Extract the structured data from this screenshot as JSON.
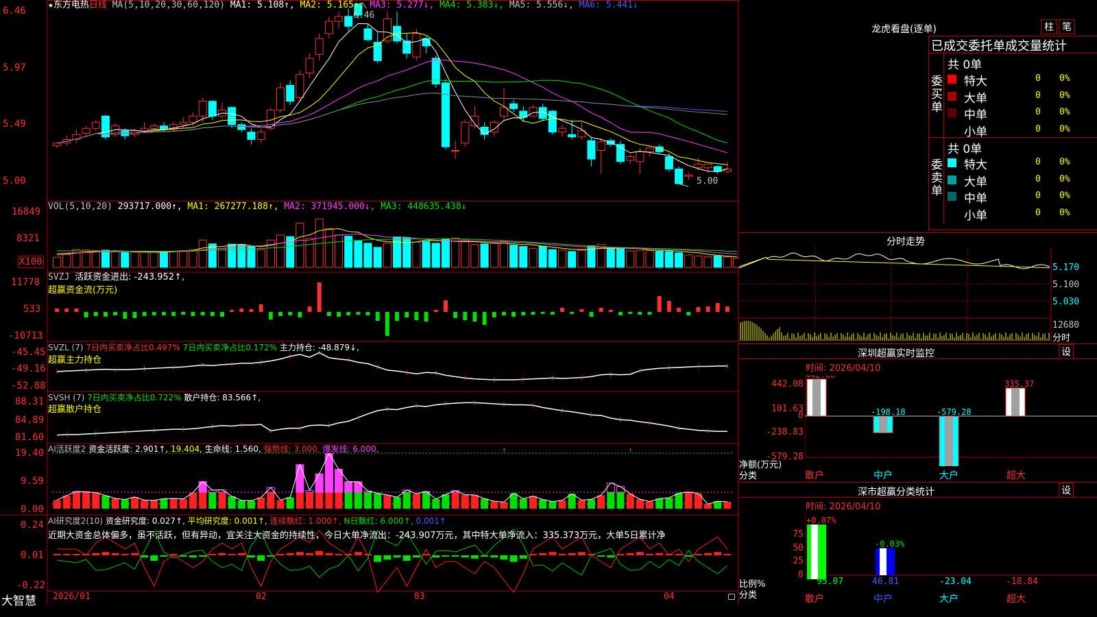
{
  "header": {
    "star": "★",
    "stock_name": "东方电热",
    "period": "日线",
    "ma_params": "MA(5,10,20,30,60,120)",
    "ma1": "MA1: 5.108↑,",
    "ma2": "MA2: 5.165↑,",
    "ma3": "MA3: 5.277↓,",
    "ma4": "MA4: 5.383↓,",
    "ma5": "MA5: 5.556↓,",
    "ma6": "MA6: 5.441↓"
  },
  "price_panel": {
    "y_ticks": [
      "6.46",
      "5.97",
      "5.49",
      "5.00"
    ],
    "high_label": "6.46",
    "low_label": "5.00"
  },
  "vol_panel": {
    "name": "VOL(5,10,20)",
    "value": "293717.000↑,",
    "ma1": "MA1: 267277.188↑,",
    "ma2": "MA2: 371945.000↓,",
    "ma3": "MA3: 448635.438↓",
    "y_ticks": [
      "16849",
      "8321"
    ],
    "unit": "X100"
  },
  "svzj_panel": {
    "name": "SVZJ",
    "label": "活跃资金进出: -243.952↑,",
    "subtitle": "超赢资金流(万元)",
    "y_ticks": [
      "11778",
      "533",
      "-10713"
    ]
  },
  "svzl_panel": {
    "name": "SVZL (7)",
    "label1": "7日内买卖净占比0.497%",
    "label2": "7日内买卖净占比0.172%",
    "label3": "主力持仓: -48.879↓,",
    "subtitle": "超赢主力持仓",
    "y_ticks": [
      "-45.45",
      "-49.16",
      "-52.88"
    ]
  },
  "svsh_panel": {
    "name": "SVSH (7)",
    "label1": "7日内买卖净占比0.722%",
    "label2": "散户持仓: 83.566↑,",
    "subtitle": "超赢散户持仓",
    "y_ticks": [
      "88.31",
      "84.89",
      "81.60"
    ]
  },
  "ai_active": {
    "name": "AI活跃度2",
    "label1": "资金活跃度: 2.901↑,",
    "label2": "19.404,",
    "label3": "生命线: 1.560,",
    "label4": "强势线: 3.000,",
    "label5": "爆发线: 6.000,",
    "y_ticks": [
      "19.40",
      "9.59",
      "0.00"
    ]
  },
  "ai_research": {
    "name": "AI研究度2(10)",
    "label1": "资金研究度: 0.027↑,",
    "label2": "平均研究度: 0.001↑,",
    "label3": "连续飘红: 1.000↑,",
    "label4": "N日飘红: 6.000↑,",
    "label5": "0.001↑",
    "comment": "近期大资金总体偏多，虽不活跃，但有异动，宜关注大资金的持续性，今日大单净流出：-243.907万元，其中特大单净流入：335.373万元，大单5日累计净",
    "y_ticks": [
      "0.24",
      "0.01",
      "-0.22"
    ]
  },
  "date_axis": [
    "2026/01",
    "02",
    "03",
    "04"
  ],
  "bottom_logo": "大智慧",
  "longhu": {
    "title": "龙虎看盘(逐单)",
    "btn1": "柱",
    "btn2": "笔",
    "tabs": [
      "已成交",
      "委托单",
      "成交量统计"
    ],
    "buy_side": "委买单",
    "sell_side": "委卖单",
    "buy_total": "共 0单",
    "sell_total": "共 0单",
    "buy_rows": [
      {
        "label": "特大",
        "val": "0",
        "pct": "0%",
        "color": "#ff0000"
      },
      {
        "label": "大单",
        "val": "0",
        "pct": "0%",
        "color": "#a00000"
      },
      {
        "label": "中单",
        "val": "0",
        "pct": "0%",
        "color": "#600000"
      },
      {
        "label": "小单",
        "val": "0",
        "pct": "0%",
        "color": "#000000"
      }
    ],
    "sell_rows": [
      {
        "label": "特大",
        "val": "0",
        "pct": "0%",
        "color": "#00ffff"
      },
      {
        "label": "大单",
        "val": "0",
        "pct": "0%",
        "color": "#00a0a0"
      },
      {
        "label": "中单",
        "val": "0",
        "pct": "0%",
        "color": "#006868"
      },
      {
        "label": "小单",
        "val": "0",
        "pct": "0%",
        "color": "#000000"
      }
    ]
  },
  "timeshare": {
    "title": "分时走势",
    "y_ticks": [
      "5.170",
      "5.100",
      "5.030"
    ],
    "vol_tick": "12680",
    "vol_unit": "分时"
  },
  "sz_monitor": {
    "title": "深圳超赢实时监控",
    "btn": "设",
    "time": "时间: 2026/04/10",
    "y_ticks": [
      "442.08",
      "101.63",
      "0",
      "-238.83",
      "-579.28"
    ],
    "unit1": "净额(万元)",
    "unit2": "分类",
    "categories": [
      "散户",
      "中户",
      "大户",
      "超大"
    ],
    "values": [
      442.08,
      -198.18,
      -579.28,
      335.37
    ],
    "value_labels": [
      "442.08",
      "-198.18",
      "-579.28",
      "335.37"
    ]
  },
  "sz_category": {
    "title": "深市超赢分类统计",
    "btn": "设",
    "time": "时间: 2026/04/10",
    "y_ticks": [
      "75",
      "50",
      "25",
      "0"
    ],
    "unit1": "比例%",
    "unit2": "分类",
    "categories": [
      "散户",
      "中户",
      "大户",
      "超大"
    ],
    "top_labels": [
      "+0.07%",
      "-0.03%"
    ],
    "values": [
      95.07,
      46.81,
      -23.04,
      -18.84
    ],
    "value_labels": [
      "95.07",
      "46.81",
      "-23.04",
      "-18.84"
    ]
  },
  "colors": {
    "up": "#ff3030",
    "down": "#00ffff",
    "ma1": "#ffffff",
    "ma2": "#ffff00",
    "ma3": "#ff40ff",
    "ma4": "#00e000",
    "ma5": "#808080",
    "ma6": "#4060ff",
    "grid": "#b00000"
  },
  "chart_data": {
    "type": "candlestick",
    "title": "东方电热 日线",
    "x_range": [
      "2026/01",
      "2026/04/10"
    ],
    "y_range": [
      5.0,
      6.46
    ],
    "marked_high": 6.46,
    "marked_low": 5.0,
    "last_ma": {
      "MA1": 5.108,
      "MA2": 5.165,
      "MA3": 5.277,
      "MA4": 5.383,
      "MA5": 5.556,
      "MA6": 5.441
    },
    "candles": [
      {
        "o": 5.31,
        "c": 5.33,
        "h": 5.34,
        "l": 5.29
      },
      {
        "o": 5.33,
        "c": 5.36,
        "h": 5.39,
        "l": 5.31
      },
      {
        "o": 5.36,
        "c": 5.4,
        "h": 5.44,
        "l": 5.33
      },
      {
        "o": 5.41,
        "c": 5.45,
        "h": 5.47,
        "l": 5.38
      },
      {
        "o": 5.45,
        "c": 5.5,
        "h": 5.52,
        "l": 5.43
      },
      {
        "o": 5.55,
        "c": 5.38,
        "h": 5.56,
        "l": 5.36
      },
      {
        "o": 5.4,
        "c": 5.47,
        "h": 5.49,
        "l": 5.38
      },
      {
        "o": 5.43,
        "c": 5.39,
        "h": 5.45,
        "l": 5.36
      },
      {
        "o": 5.4,
        "c": 5.43,
        "h": 5.45,
        "l": 5.38
      },
      {
        "o": 5.43,
        "c": 5.45,
        "h": 5.5,
        "l": 5.41
      },
      {
        "o": 5.45,
        "c": 5.47,
        "h": 5.49,
        "l": 5.43
      },
      {
        "o": 5.47,
        "c": 5.44,
        "h": 5.5,
        "l": 5.42
      },
      {
        "o": 5.44,
        "c": 5.48,
        "h": 5.5,
        "l": 5.42
      },
      {
        "o": 5.48,
        "c": 5.5,
        "h": 5.54,
        "l": 5.45
      },
      {
        "o": 5.5,
        "c": 5.55,
        "h": 5.58,
        "l": 5.47
      },
      {
        "o": 5.55,
        "c": 5.67,
        "h": 5.7,
        "l": 5.5
      },
      {
        "o": 5.67,
        "c": 5.55,
        "h": 5.68,
        "l": 5.52
      },
      {
        "o": 5.55,
        "c": 5.6,
        "h": 5.66,
        "l": 5.53
      },
      {
        "o": 5.62,
        "c": 5.48,
        "h": 5.63,
        "l": 5.45
      },
      {
        "o": 5.48,
        "c": 5.44,
        "h": 5.5,
        "l": 5.42
      },
      {
        "o": 5.42,
        "c": 5.36,
        "h": 5.45,
        "l": 5.32
      },
      {
        "o": 5.36,
        "c": 5.42,
        "h": 5.45,
        "l": 5.33
      },
      {
        "o": 5.45,
        "c": 5.6,
        "h": 5.62,
        "l": 5.43
      },
      {
        "o": 5.6,
        "c": 5.78,
        "h": 5.82,
        "l": 5.58
      },
      {
        "o": 5.8,
        "c": 5.67,
        "h": 5.84,
        "l": 5.64
      },
      {
        "o": 5.7,
        "c": 5.89,
        "h": 5.92,
        "l": 5.68
      },
      {
        "o": 5.9,
        "c": 6.02,
        "h": 6.06,
        "l": 5.86
      },
      {
        "o": 6.05,
        "c": 6.18,
        "h": 6.22,
        "l": 6.0
      },
      {
        "o": 6.22,
        "c": 6.32,
        "h": 6.36,
        "l": 6.18
      },
      {
        "o": 6.32,
        "c": 6.36,
        "h": 6.4,
        "l": 6.26
      },
      {
        "o": 6.36,
        "c": 6.28,
        "h": 6.42,
        "l": 6.24
      },
      {
        "o": 6.46,
        "c": 6.37,
        "h": 6.46,
        "l": 6.34
      },
      {
        "o": 6.26,
        "c": 6.17,
        "h": 6.3,
        "l": 6.16
      },
      {
        "o": 6.15,
        "c": 6.0,
        "h": 6.24,
        "l": 5.98
      },
      {
        "o": 6.16,
        "c": 6.34,
        "h": 6.4,
        "l": 6.14
      },
      {
        "o": 6.28,
        "c": 6.16,
        "h": 6.4,
        "l": 6.14
      },
      {
        "o": 6.16,
        "c": 6.06,
        "h": 6.22,
        "l": 6.02
      },
      {
        "o": 6.03,
        "c": 6.22,
        "h": 6.26,
        "l": 6.0
      },
      {
        "o": 6.18,
        "c": 6.12,
        "h": 6.2,
        "l": 6.06
      },
      {
        "o": 6.02,
        "c": 5.81,
        "h": 6.04,
        "l": 5.78
      },
      {
        "o": 5.82,
        "c": 5.3,
        "h": 5.85,
        "l": 5.28
      },
      {
        "o": 5.27,
        "c": 5.27,
        "h": 5.35,
        "l": 5.2
      },
      {
        "o": 5.33,
        "c": 5.5,
        "h": 5.52,
        "l": 5.3
      },
      {
        "o": 5.47,
        "c": 5.55,
        "h": 5.63,
        "l": 5.45
      },
      {
        "o": 5.46,
        "c": 5.4,
        "h": 5.5,
        "l": 5.36
      },
      {
        "o": 5.42,
        "c": 5.5,
        "h": 5.52,
        "l": 5.38
      },
      {
        "o": 5.55,
        "c": 5.62,
        "h": 5.78,
        "l": 5.52
      },
      {
        "o": 5.65,
        "c": 5.61,
        "h": 5.68,
        "l": 5.58
      },
      {
        "o": 5.59,
        "c": 5.54,
        "h": 5.63,
        "l": 5.5
      },
      {
        "o": 5.55,
        "c": 5.62,
        "h": 5.64,
        "l": 5.54
      },
      {
        "o": 5.62,
        "c": 5.53,
        "h": 5.65,
        "l": 5.51
      },
      {
        "o": 5.59,
        "c": 5.42,
        "h": 5.6,
        "l": 5.4
      },
      {
        "o": 5.42,
        "c": 5.45,
        "h": 5.48,
        "l": 5.38
      },
      {
        "o": 5.4,
        "c": 5.38,
        "h": 5.52,
        "l": 5.36
      },
      {
        "o": 5.38,
        "c": 5.43,
        "h": 5.5,
        "l": 5.36
      },
      {
        "o": 5.35,
        "c": 5.2,
        "h": 5.38,
        "l": 5.14
      },
      {
        "o": 5.27,
        "c": 5.34,
        "h": 5.37,
        "l": 5.08
      },
      {
        "o": 5.35,
        "c": 5.32,
        "h": 5.37,
        "l": 5.3
      },
      {
        "o": 5.32,
        "c": 5.18,
        "h": 5.35,
        "l": 5.16
      },
      {
        "o": 5.19,
        "c": 5.22,
        "h": 5.24,
        "l": 5.16
      },
      {
        "o": 5.18,
        "c": 5.26,
        "h": 5.29,
        "l": 5.08
      },
      {
        "o": 5.26,
        "c": 5.29,
        "h": 5.31,
        "l": 5.22
      },
      {
        "o": 5.3,
        "c": 5.26,
        "h": 5.32,
        "l": 5.24
      },
      {
        "o": 5.22,
        "c": 5.12,
        "h": 5.25,
        "l": 5.1
      },
      {
        "o": 5.12,
        "c": 5.0,
        "h": 5.14,
        "l": 5.0
      },
      {
        "o": 5.06,
        "c": 5.07,
        "h": 5.09,
        "l": 5.03
      },
      {
        "o": 5.13,
        "c": 5.16,
        "h": 5.21,
        "l": 5.11
      },
      {
        "o": 5.13,
        "c": 5.16,
        "h": 5.16,
        "l": 5.09
      },
      {
        "o": 5.14,
        "c": 5.1,
        "h": 5.15,
        "l": 5.08
      },
      {
        "o": 5.1,
        "c": 5.12,
        "h": 5.18,
        "l": 5.09
      }
    ],
    "volume": [
      3.2,
      4.1,
      5.6,
      5.5,
      5.3,
      5.4,
      5.0,
      4.7,
      4.8,
      4.9,
      4.8,
      4.9,
      5.0,
      5.3,
      5.6,
      8.6,
      7.4,
      5.9,
      7.3,
      7.2,
      6.5,
      5.6,
      8.6,
      10.2,
      9.7,
      13.9,
      9.1,
      15.2,
      12.2,
      10.2,
      9.8,
      8.3,
      7.6,
      6.3,
      7.6,
      9.6,
      9.4,
      8.0,
      8.2,
      7.6,
      9.0,
      9.2,
      8.6,
      7.2,
      7.4,
      7.8,
      8.2,
      7.0,
      6.6,
      6.0,
      6.6,
      5.6,
      5.4,
      5.0,
      5.4,
      6.8,
      7.2,
      6.0,
      5.8,
      5.2,
      5.4,
      5.3,
      5.1,
      5.0,
      4.6,
      3.9,
      3.6,
      3.3,
      3.6,
      3.3,
      2.9
    ],
    "vol_ma5": [
      4.0,
      4.2,
      4.5,
      4.8,
      5.0,
      5.1,
      5.2,
      5.1,
      4.9,
      4.8,
      4.8,
      4.8,
      4.9,
      5.1,
      5.3,
      6.1,
      6.4,
      6.6,
      7.0,
      7.3,
      6.8,
      6.5,
      7.0,
      7.6,
      8.1,
      9.6,
      10.2,
      11.6,
      12.0,
      12.2,
      11.3,
      11.1,
      9.5,
      8.5,
      8.1,
      7.9,
      7.8,
      8.0,
      8.6,
      8.4,
      8.4,
      8.2,
      8.1,
      8.1,
      7.9,
      7.6,
      7.6,
      7.4,
      7.2,
      7.1,
      6.7,
      6.4,
      6.0,
      5.7,
      5.6,
      5.7,
      6.0,
      6.0,
      6.0,
      6.0,
      5.9,
      5.5,
      5.4,
      5.3,
      5.1,
      4.8,
      4.6,
      4.1,
      3.8,
      3.5,
      3.3
    ],
    "vol_ma10": [
      4.4,
      4.5,
      4.6,
      4.7,
      4.8,
      4.9,
      4.9,
      5.0,
      5.0,
      5.0,
      5.0,
      5.0,
      5.0,
      5.0,
      5.1,
      5.5,
      5.8,
      6.0,
      6.3,
      6.6,
      6.7,
      6.8,
      7.2,
      7.6,
      8.0,
      8.5,
      8.6,
      9.3,
      9.7,
      10.2,
      10.3,
      10.5,
      10.2,
      10.0,
      9.5,
      9.6,
      9.5,
      9.1,
      8.9,
      8.6,
      8.4,
      8.3,
      8.3,
      8.3,
      8.2,
      8.1,
      8.0,
      7.9,
      7.8,
      7.6,
      7.4,
      7.1,
      6.9,
      6.7,
      6.5,
      6.4,
      6.3,
      6.2,
      6.1,
      6.0,
      5.9,
      5.9,
      5.8,
      5.7,
      5.6,
      5.4,
      5.2,
      4.9,
      4.6,
      4.4,
      4.2
    ],
    "vol_ma20": [
      5.2,
      5.2,
      5.2,
      5.1,
      5.1,
      5.1,
      5.1,
      5.1,
      5.1,
      5.1,
      5.1,
      5.1,
      5.1,
      5.2,
      5.2,
      5.3,
      5.4,
      5.5,
      5.6,
      5.7,
      5.8,
      5.9,
      6.1,
      6.3,
      6.6,
      6.9,
      7.2,
      7.5,
      7.8,
      8.1,
      8.3,
      8.5,
      8.7,
      8.8,
      8.8,
      8.9,
      9.0,
      9.0,
      9.0,
      9.0,
      9.0,
      9.0,
      8.9,
      8.8,
      8.7,
      8.6,
      8.4,
      8.2,
      8.1,
      7.9,
      7.7,
      7.5,
      7.3,
      7.1,
      6.9,
      6.7,
      6.5,
      6.4,
      6.3,
      6.2,
      6.1,
      6.0,
      5.9,
      5.8,
      5.7,
      5.6,
      5.5,
      5.4,
      5.3,
      5.1,
      5.0
    ],
    "svzj": [
      0.5,
      0.5,
      0.5,
      -0.8,
      -0.6,
      -0.7,
      -0.5,
      -1.0,
      -0.9,
      -0.6,
      -0.5,
      -0.5,
      -0.6,
      -0.4,
      -0.6,
      -0.5,
      -0.6,
      -0.7,
      0.3,
      0.5,
      0.4,
      1.1,
      -1.1,
      -0.6,
      -0.5,
      -0.8,
      0.8,
      4.3,
      -0.6,
      -0.7,
      -0.5,
      -0.4,
      -0.5,
      -1.3,
      -3.5,
      -1.3,
      -0.8,
      -1.2,
      -1.4,
      0.3,
      1.7,
      -0.9,
      -1.2,
      -1.4,
      -1.9,
      -0.8,
      -0.5,
      -0.7,
      -0.5,
      -0.4,
      -0.3,
      -0.4,
      0.6,
      -0.3,
      0.4,
      -0.7,
      0.6,
      0.3,
      -0.5,
      -0.3,
      -0.4,
      -0.4,
      2.3,
      1.6,
      0.6,
      -0.5,
      0.7,
      0.8,
      1.3,
      0.8,
      -0.7,
      -0.6,
      -0.5,
      0.6,
      -1.1,
      0.5
    ],
    "svzl": [
      -49.9,
      -49.8,
      -49.7,
      -49.6,
      -49.5,
      -49.4,
      -49.5,
      -49.5,
      -49.4,
      -49.3,
      -49.2,
      -49.1,
      -49.0,
      -48.9,
      -48.7,
      -48.5,
      -48.6,
      -48.4,
      -48.3,
      -48.1,
      -48.1,
      -47.9,
      -47.6,
      -47.2,
      -46.6,
      -46.2,
      -46.8,
      -45.8,
      -46.9,
      -47.2,
      -47.4,
      -47.9,
      -48.2,
      -48.9,
      -49.6,
      -49.8,
      -50.1,
      -50.4,
      -50.1,
      -50.2,
      -50.7,
      -51.0,
      -51.3,
      -51.5,
      -51.6,
      -51.7,
      -51.7,
      -51.7,
      -51.6,
      -51.5,
      -51.4,
      -51.3,
      -51.4,
      -51.3,
      -51.2,
      -51.0,
      -50.6,
      -50.5,
      -50.6,
      -50.5,
      -49.7,
      -49.4,
      -49.2,
      -49.1,
      -49.0,
      -48.9,
      -48.8,
      -48.8,
      -48.7,
      -48.7,
      -48.5,
      -48.4,
      -48.3,
      -48.3,
      -48.5,
      -48.9,
      -48.8,
      -48.9
    ],
    "svsh": [
      81.9,
      82.0,
      82.0,
      82.1,
      82.2,
      82.3,
      82.4,
      82.5,
      82.6,
      82.7,
      82.8,
      82.9,
      83.0,
      83.0,
      83.1,
      83.3,
      83.5,
      83.7,
      83.6,
      83.8,
      83.8,
      83.9,
      82.7,
      83.0,
      83.2,
      83.2,
      83.7,
      83.8,
      83.7,
      84.2,
      84.5,
      85.2,
      85.9,
      86.5,
      86.8,
      86.7,
      87.1,
      87.4,
      87.3,
      87.6,
      87.8,
      87.9,
      88.0,
      88.0,
      87.9,
      87.8,
      87.7,
      87.6,
      87.6,
      87.5,
      87.1,
      86.8,
      86.5,
      86.3,
      86.0,
      85.7,
      85.6,
      85.1,
      84.8,
      84.7,
      84.4,
      84.2,
      83.9,
      83.6,
      83.2,
      83.0,
      82.8,
      82.7,
      82.6,
      82.6,
      82.5,
      82.6,
      82.6,
      82.6,
      82.5,
      82.6,
      82.6,
      82.6
    ],
    "ai_active": [
      3.0,
      4.6,
      6.0,
      5.9,
      5.6,
      4.6,
      3.6,
      3.2,
      4.1,
      3.0,
      2.9,
      3.5,
      3.6,
      3.4,
      5.6,
      9.5,
      6.5,
      6.6,
      4.3,
      2.9,
      2.8,
      3.9,
      7.4,
      3.0,
      4.0,
      15.4,
      6.4,
      12.2,
      19.3,
      13.8,
      9.4,
      9.4,
      6.2,
      5.4,
      4.8,
      4.0,
      6.5,
      5.2,
      6.0,
      3.4,
      5.0,
      6.3,
      4.9,
      4.8,
      3.5,
      2.6,
      2.3,
      5.4,
      3.5,
      4.4,
      3.2,
      2.5,
      2.9,
      5.2,
      3.0,
      3.3,
      4.7,
      9.0,
      7.7,
      5.2,
      3.3,
      2.5,
      3.5,
      3.8,
      5.4,
      5.8,
      5.3,
      1.6,
      2.6,
      2.4,
      2.3,
      1.6,
      2.9,
      3.2,
      2.2,
      2.9
    ],
    "ai_research": [
      0.01,
      0.01,
      0.01,
      0.0,
      0.02,
      0.03,
      0.02,
      0.01,
      0.02,
      -0.02,
      -0.05,
      -0.01,
      0.0,
      -0.01,
      -0.02,
      -0.01,
      0.01,
      0.02,
      0.01,
      0.02,
      -0.02,
      -0.05,
      -0.01,
      0.01,
      0.02,
      0.03,
      0.02,
      0.04,
      0.02,
      0.01,
      0.0,
      0.03,
      0.0,
      -0.06,
      -0.04,
      -0.02,
      -0.05,
      -0.02,
      0.01,
      -0.02,
      -0.01,
      -0.01,
      -0.02,
      -0.03,
      -0.01,
      -0.02,
      -0.04,
      -0.06,
      -0.03,
      0.01,
      0.02,
      0.03,
      0.01,
      0.02,
      0.03,
      0.0,
      -0.01,
      -0.02,
      0.01,
      0.02,
      0.03,
      0.01,
      0.02,
      0.0,
      0.01,
      -0.01,
      0.01,
      0.02,
      0.03,
      0.01,
      -0.02,
      -0.05,
      0.02,
      0.027
    ]
  }
}
